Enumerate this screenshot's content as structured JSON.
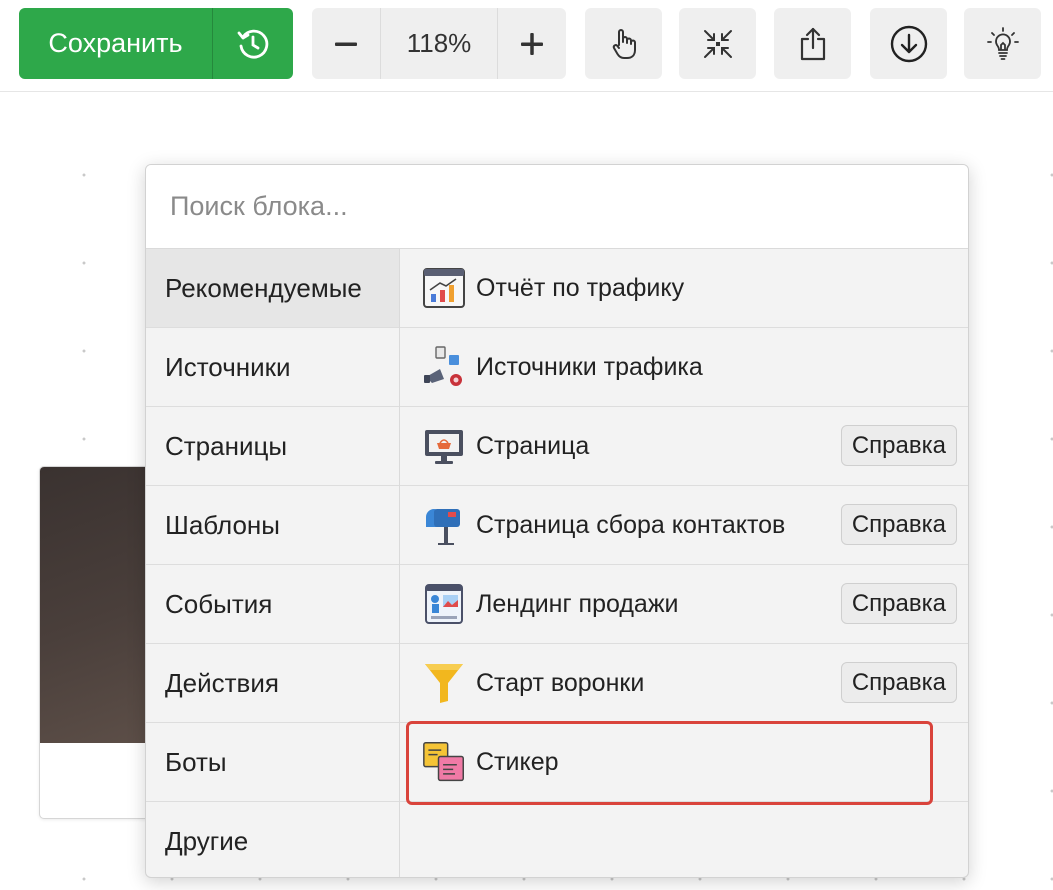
{
  "toolbar": {
    "save_label": "Сохранить",
    "zoom_value": "118%",
    "icons": [
      "history-icon",
      "minus-icon",
      "plus-icon",
      "hand-pointer-icon",
      "collapse-icon",
      "share-icon",
      "download-icon",
      "lightbulb-icon"
    ]
  },
  "picker": {
    "search_placeholder": "Поиск блока...",
    "categories": [
      {
        "label": "Рекомендуемые",
        "active": true
      },
      {
        "label": "Источники"
      },
      {
        "label": "Страницы"
      },
      {
        "label": "Шаблоны"
      },
      {
        "label": "События"
      },
      {
        "label": "Действия"
      },
      {
        "label": "Боты"
      },
      {
        "label": "Другие"
      }
    ],
    "blocks": [
      {
        "label": "Отчёт по трафику",
        "icon": "traffic-report-icon"
      },
      {
        "label": "Источники трафика",
        "icon": "traffic-sources-icon"
      },
      {
        "label": "Страница",
        "icon": "page-monitor-icon",
        "help": "Справка"
      },
      {
        "label": "Страница сбора контактов",
        "icon": "mailbox-icon",
        "help": "Справка"
      },
      {
        "label": "Лендинг продажи",
        "icon": "landing-icon",
        "help": "Справка"
      },
      {
        "label": "Старт воронки",
        "icon": "funnel-icon",
        "help": "Справка"
      },
      {
        "label": "Стикер",
        "icon": "sticker-icon",
        "highlighted": true
      }
    ]
  },
  "colors": {
    "save_green": "#2ea84a",
    "highlight_red": "#d9433b"
  }
}
